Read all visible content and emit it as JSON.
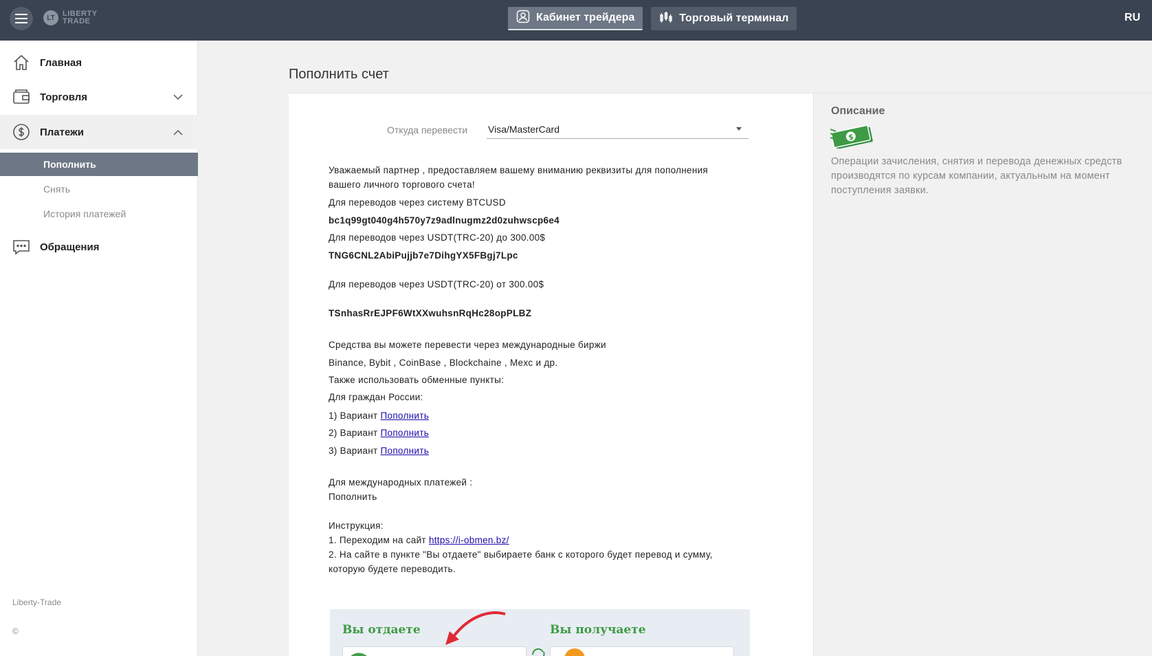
{
  "header": {
    "logo_top": "LIBERTY",
    "logo_bottom": "TRADE",
    "logo_mark": "LT",
    "tabs": [
      {
        "label": "Кабинет трейдера",
        "icon": "user-icon",
        "active": true
      },
      {
        "label": "Торговый терминал",
        "icon": "chart-candles-icon",
        "active": false
      }
    ],
    "lang": "RU"
  },
  "sidebar": {
    "items": [
      {
        "label": "Главная",
        "icon": "home-icon"
      },
      {
        "label": "Торговля",
        "icon": "wallet-icon"
      },
      {
        "label": "Платежи",
        "icon": "dollar-circle-icon"
      },
      {
        "label": "Обращения",
        "icon": "chat-icon"
      }
    ],
    "payments_sub": [
      {
        "label": "Пополнить",
        "active": true
      },
      {
        "label": "Снять",
        "active": false
      },
      {
        "label": "История платежей",
        "active": false
      }
    ],
    "footer_brand": "Liberty-Trade",
    "footer_copy": "©"
  },
  "main": {
    "title": "Пополнить счет",
    "from_label": "Откуда перевести",
    "from_value": "Visa/MasterCard",
    "lines": {
      "intro1": "Уважаемый партнер , предоставляем вашему вниманию реквизиты для пополнения",
      "intro2": "вашего личного торгового счета!",
      "btc_label": "Для переводов через систему BTCUSD",
      "btc_addr": "bc1q99gt040g4h570y7z9adlnugmz2d0zuhwscp6e4",
      "usdt1_label": "Для переводов через USDT(TRC-20) до 300.00$",
      "usdt1_addr": "TNG6CNL2AbiPujjb7e7DihgYX5FBgj7Lpc",
      "usdt2_label": "Для переводов через USDT(TRC-20) от 300.00$",
      "usdt2_addr": "TSnhasRrEJPF6WtXXwuhsnRqHc28opPLBZ",
      "exchanges1": "Средства вы можете перевести через международные биржи",
      "exchanges2": "Binance, Bybit , CoinBase , Blockchaine , Mexc и др.",
      "exchangers": "Также использовать обменные пункты:",
      "russia": "Для граждан России:",
      "variant1": "1) Вариант ",
      "variant2": "2) Вариант ",
      "variant3": "3) Вариант ",
      "variant_link": "Пополнить",
      "intl": "Для международных платежей :",
      "intl_link": "Пополнить",
      "instr": "Инструкция:",
      "step1": "1. Переходим на сайт ",
      "step1_link": "https://i-obmen.bz/",
      "step2a": "2. На сайте в пункте \"Вы отдаете\" выбираете банк с которого будет перевод и сумму,",
      "step2b": "которую будете переводить."
    },
    "screenshot": {
      "give": "Вы отдаете",
      "get": "Вы получаете"
    }
  },
  "description": {
    "title": "Описание",
    "text": "Операции зачисления, снятия и перевода денежных средств производятся по курсам компании, актуальным на момент поступления заявки."
  },
  "colors": {
    "topbar": "#3a4351",
    "active_sub": "#6e7785",
    "money_green": "#3e9a45"
  }
}
